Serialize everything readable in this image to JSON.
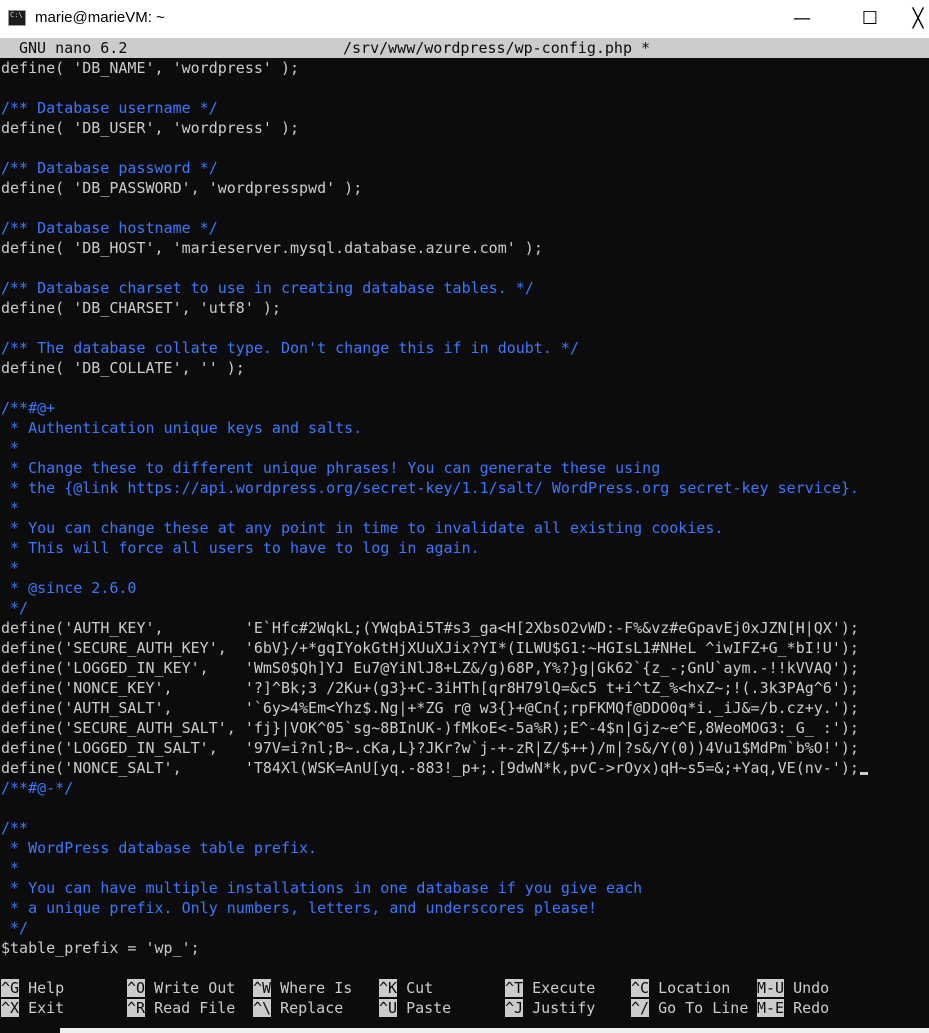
{
  "window": {
    "title": "marie@marieVM: ~",
    "minimize": "—",
    "maximize": "☐",
    "close": "╳"
  },
  "nano": {
    "version": "GNU nano 6.2",
    "filename": "/srv/www/wordpress/wp-config.php *"
  },
  "lines": [
    {
      "text": "define( 'DB_NAME', 'wordpress' );",
      "comment": false
    },
    {
      "text": "",
      "comment": false
    },
    {
      "text": "/** Database username */",
      "comment": true
    },
    {
      "text": "define( 'DB_USER', 'wordpress' );",
      "comment": false
    },
    {
      "text": "",
      "comment": false
    },
    {
      "text": "/** Database password */",
      "comment": true
    },
    {
      "text": "define( 'DB_PASSWORD', 'wordpresspwd' );",
      "comment": false
    },
    {
      "text": "",
      "comment": false
    },
    {
      "text": "/** Database hostname */",
      "comment": true
    },
    {
      "text": "define( 'DB_HOST', 'marieserver.mysql.database.azure.com' );",
      "comment": false
    },
    {
      "text": "",
      "comment": false
    },
    {
      "text": "/** Database charset to use in creating database tables. */",
      "comment": true
    },
    {
      "text": "define( 'DB_CHARSET', 'utf8' );",
      "comment": false
    },
    {
      "text": "",
      "comment": false
    },
    {
      "text": "/** The database collate type. Don't change this if in doubt. */",
      "comment": true
    },
    {
      "text": "define( 'DB_COLLATE', '' );",
      "comment": false
    },
    {
      "text": "",
      "comment": false
    },
    {
      "text": "/**#@+",
      "comment": true
    },
    {
      "text": " * Authentication unique keys and salts.",
      "comment": true
    },
    {
      "text": " *",
      "comment": true
    },
    {
      "text": " * Change these to different unique phrases! You can generate these using",
      "comment": true
    },
    {
      "text": " * the {@link https://api.wordpress.org/secret-key/1.1/salt/ WordPress.org secret-key service}.",
      "comment": true
    },
    {
      "text": " *",
      "comment": true
    },
    {
      "text": " * You can change these at any point in time to invalidate all existing cookies.",
      "comment": true
    },
    {
      "text": " * This will force all users to have to log in again.",
      "comment": true
    },
    {
      "text": " *",
      "comment": true
    },
    {
      "text": " * @since 2.6.0",
      "comment": true
    },
    {
      "text": " */",
      "comment": true
    },
    {
      "text": "define('AUTH_KEY',         'E`Hfc#2WqkL;(YWqbAi5T#s3_ga<H[2XbsO2vWD:-F%&vz#eGpavEj0xJZN[H|QX');",
      "comment": false
    },
    {
      "text": "define('SECURE_AUTH_KEY',  '6bV}/+*gqIYokGtHjXUuXJix?YI*(ILWU$G1:~HGIsL1#NHeL ^iwIFZ+G_*bI!U');",
      "comment": false
    },
    {
      "text": "define('LOGGED_IN_KEY',    'WmS0$Qh]YJ Eu7@YiNlJ8+LZ&/g)68P,Y%?}g|Gk62`{z_-;GnU`aym.-!!kVVAQ');",
      "comment": false
    },
    {
      "text": "define('NONCE_KEY',        '?]^Bk;3 /2Ku+(g3}+C-3iHTh[qr8H79lQ=&c5 t+i^tZ_%<hxZ~;!(.3k3PAg^6');",
      "comment": false
    },
    {
      "text": "define('AUTH_SALT',        '`6y>4%Em<Yhz$.Ng|+*ZG r@ w3{}+@Cn{;rpFKMQf@DDO0q*i._iJ&=/b.cz+y.');",
      "comment": false
    },
    {
      "text": "define('SECURE_AUTH_SALT', 'fj}|VOK^05`sg~8BInUK-)fMkoE<-5a%R);E^-4$n|Gjz~e^E,8WeoMOG3:_G_ :');",
      "comment": false
    },
    {
      "text": "define('LOGGED_IN_SALT',   '97V=i?nl;B~.cKa,L}?JKr?w`j-+-zR|Z/$++)/m|?s&/Y(0))4Vu1$MdPm`b%O!');",
      "comment": false
    },
    {
      "text": "define('NONCE_SALT',       'T84Xl(WSK=AnU[yq.-883!_p+;.[9dwN*k,pvC->rOyx)qH~s5=&;+Yaq,VE(nv-');",
      "comment": false
    },
    {
      "text": "/**#@-*/",
      "comment": true
    },
    {
      "text": "",
      "comment": false
    },
    {
      "text": "/**",
      "comment": true
    },
    {
      "text": " * WordPress database table prefix.",
      "comment": true
    },
    {
      "text": " *",
      "comment": true
    },
    {
      "text": " * You can have multiple installations in one database if you give each",
      "comment": true
    },
    {
      "text": " * a unique prefix. Only numbers, letters, and underscores please!",
      "comment": true
    },
    {
      "text": " */",
      "comment": true
    },
    {
      "text": "$table_prefix = 'wp_';",
      "comment": false
    }
  ],
  "shortcuts": [
    [
      {
        "key": "^G",
        "label": "Help"
      },
      {
        "key": "^O",
        "label": "Write Out"
      },
      {
        "key": "^W",
        "label": "Where Is"
      },
      {
        "key": "^K",
        "label": "Cut"
      },
      {
        "key": "^T",
        "label": "Execute"
      },
      {
        "key": "^C",
        "label": "Location"
      },
      {
        "key": "M-U",
        "label": "Undo"
      }
    ],
    [
      {
        "key": "^X",
        "label": "Exit"
      },
      {
        "key": "^R",
        "label": "Read File"
      },
      {
        "key": "^\\",
        "label": "Replace"
      },
      {
        "key": "^U",
        "label": "Paste"
      },
      {
        "key": "^J",
        "label": "Justify"
      },
      {
        "key": "^/",
        "label": "Go To Line"
      },
      {
        "key": "M-E",
        "label": "Redo"
      }
    ]
  ]
}
